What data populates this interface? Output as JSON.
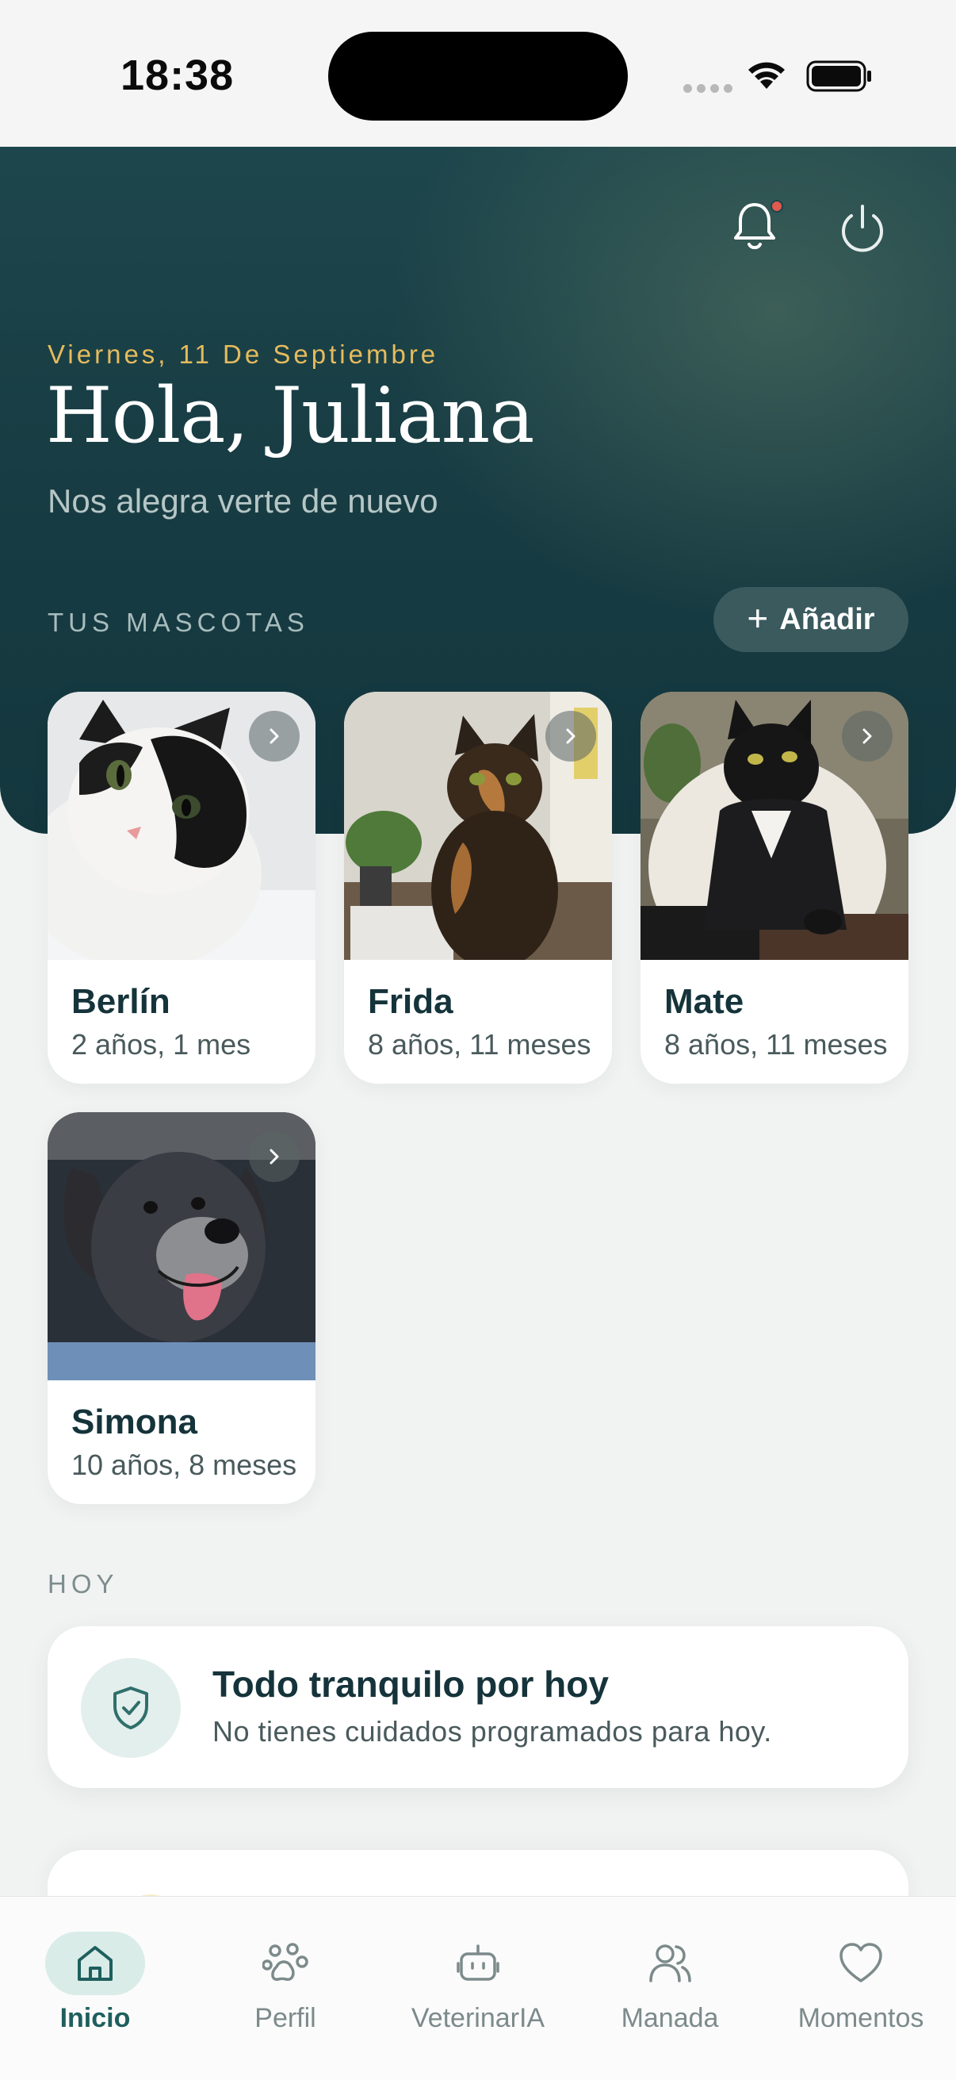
{
  "status_bar": {
    "time": "18:38"
  },
  "header": {
    "date": "Viernes, 11 De Septiembre",
    "greeting": "Hola, Juliana",
    "subtitle": "Nos alegra verte de nuevo",
    "notification_indicator": true
  },
  "pets": {
    "heading": "TUS MASCOTAS",
    "add_label": "Añadir",
    "items": [
      {
        "name": "Berlín",
        "age": "2 años, 1 mes"
      },
      {
        "name": "Frida",
        "age": "8 años, 11 meses"
      },
      {
        "name": "Mate",
        "age": "8 años, 11 meses"
      },
      {
        "name": "Simona",
        "age": "10 años, 8 meses"
      }
    ]
  },
  "today": {
    "heading": "HOY",
    "title": "Todo tranquilo por hoy",
    "text": "No tienes cuidados programados para hoy."
  },
  "nav": {
    "items": [
      {
        "label": "Inicio",
        "icon": "home-icon",
        "active": true
      },
      {
        "label": "Perfil",
        "icon": "paw-icon",
        "active": false
      },
      {
        "label": "VeterinarIA",
        "icon": "robot-icon",
        "active": false
      },
      {
        "label": "Manada",
        "icon": "users-icon",
        "active": false
      },
      {
        "label": "Momentos",
        "icon": "heart-icon",
        "active": false
      }
    ]
  },
  "colors": {
    "hero": "#173b42",
    "accent_date": "#e6bb5c",
    "active_nav": "#1e5f5e",
    "background": "#f1f3f2"
  }
}
